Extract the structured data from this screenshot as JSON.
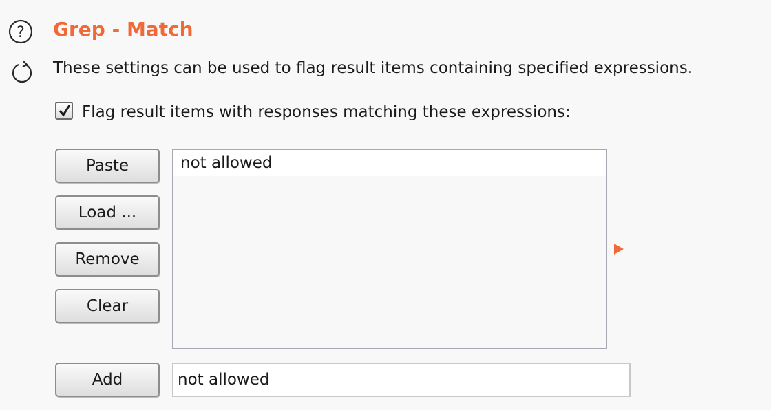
{
  "header": {
    "title": "Grep - Match",
    "description": "These settings can be used to flag result items containing specified expressions."
  },
  "option": {
    "label": "Flag result items with responses matching these expressions:",
    "checked": true
  },
  "buttons": {
    "paste": "Paste",
    "load": "Load ...",
    "remove": "Remove",
    "clear": "Clear",
    "add": "Add"
  },
  "expressions": [
    "not allowed"
  ],
  "add_input": {
    "value": "not allowed"
  },
  "colors": {
    "accent": "#f06a38"
  },
  "icons": {
    "help": "help-icon",
    "refresh": "refresh-icon",
    "expand": "expand-arrow-icon",
    "check": "checkmark-icon"
  }
}
